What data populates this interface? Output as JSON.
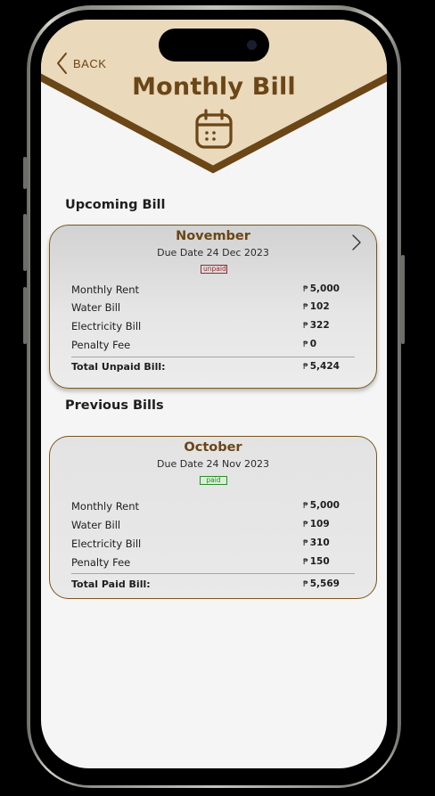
{
  "header": {
    "back_label": "BACK",
    "title": "Monthly Bill",
    "colors": {
      "band": "#ead9bb",
      "brown": "#6b4616"
    }
  },
  "upcoming": {
    "section_title": "Upcoming Bill",
    "month": "November",
    "due_date": "Due Date 24 Dec 2023",
    "status": "unpaid",
    "currency": "₱",
    "items": [
      {
        "label": "Monthly Rent",
        "amount": "5,000"
      },
      {
        "label": "Water Bill",
        "amount": "102"
      },
      {
        "label": "Electricity Bill",
        "amount": "322"
      },
      {
        "label": "Penalty Fee",
        "amount": "0"
      }
    ],
    "total_label": "Total Unpaid Bill:",
    "total_amount": "5,424"
  },
  "previous": {
    "section_title": "Previous Bills",
    "month": "October",
    "due_date": "Due Date 24 Nov 2023",
    "status": "paid",
    "currency": "₱",
    "items": [
      {
        "label": "Monthly Rent",
        "amount": "5,000"
      },
      {
        "label": "Water Bill",
        "amount": "109"
      },
      {
        "label": "Electricity Bill",
        "amount": "310"
      },
      {
        "label": "Penalty Fee",
        "amount": "150"
      }
    ],
    "total_label": "Total Paid Bill:",
    "total_amount": "5,569"
  },
  "icons": {
    "back": "chevron-left-icon",
    "calendar": "calendar-icon",
    "next": "chevron-right-icon"
  }
}
